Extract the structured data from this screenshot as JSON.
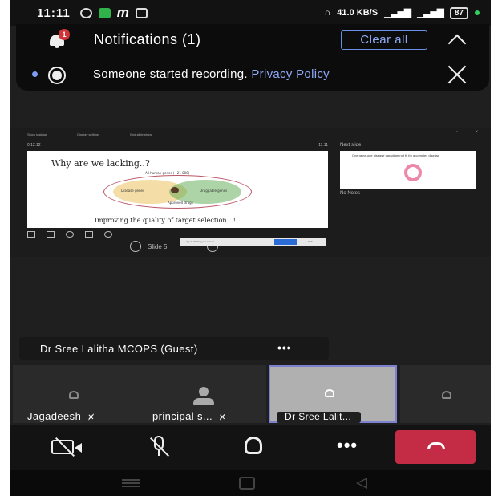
{
  "status_bar": {
    "time": "11:11",
    "network_speed": "41.0 KB/S",
    "battery": "87"
  },
  "notification_panel": {
    "title": "Notifications (1)",
    "badge_count": "1",
    "clear_all_label": "Clear all",
    "message": "Someone started recording.",
    "link_text": "Privacy Policy"
  },
  "shared_screen": {
    "toolbar_items": [
      "Show taskbar",
      "Display settings",
      "End slide show"
    ],
    "elapsed": "0:12:12",
    "clock": "11:11",
    "slide_title": "Why are we lacking..?",
    "venn_top_label": "All human genes (~21 000)",
    "venn_left_label": "Disease genes",
    "venn_right_label": "Druggable genes",
    "venn_bottom_label": "Approved drugs",
    "slide_footer": "Improving the quality of target selection…!",
    "slide_nav_text": "Slide 5",
    "share_message": "app is sharing your screen.",
    "share_stop": "Stop sharing",
    "share_hide": "Hide",
    "next_slide_label": "Next slide",
    "next_slide_text": "One gene-one disease paradigm not fit for a complex disease",
    "no_notes_label": "No Notes"
  },
  "presenter": {
    "name": "Dr Sree Lalitha MCOPS (Guest)",
    "more_label": "•••"
  },
  "participants": [
    {
      "name": "Jagadeesh"
    },
    {
      "name": "principal s..."
    },
    {
      "name": "Dr Sree Lalit..."
    }
  ],
  "call_controls": {
    "more_label": "•••"
  },
  "colors": {
    "hangup": "#c42b45",
    "accent": "#7e80d0",
    "link": "#8ea8f5",
    "badge": "#d13438"
  }
}
